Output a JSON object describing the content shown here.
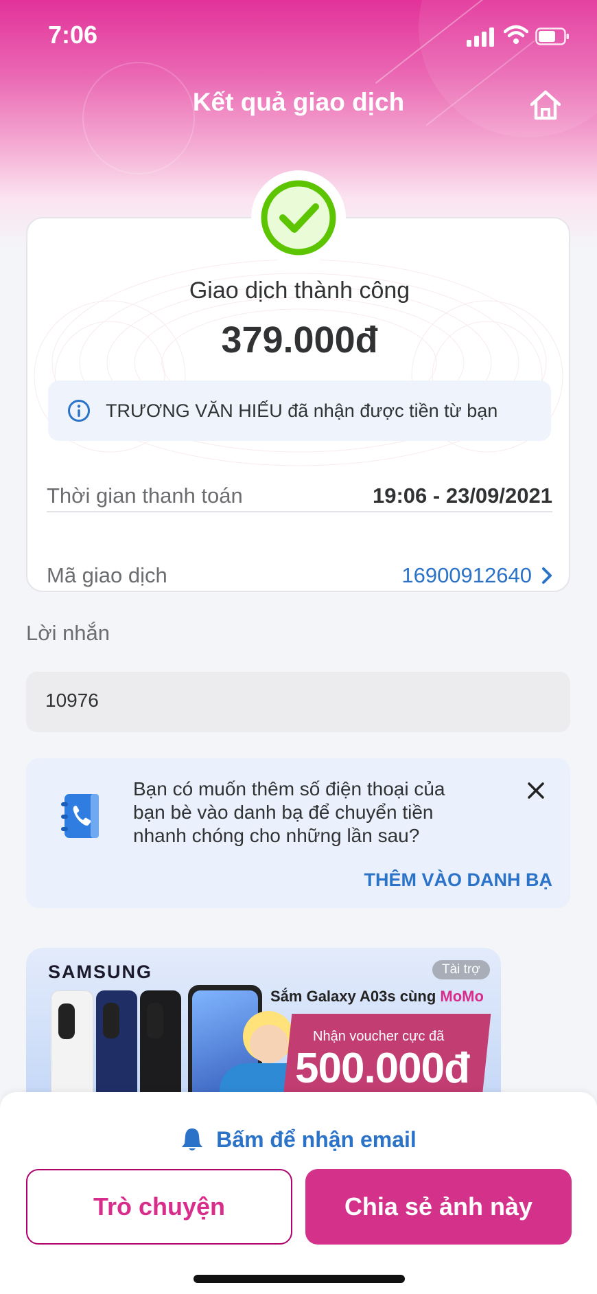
{
  "status_bar": {
    "time": "7:06"
  },
  "header": {
    "title": "Kết quả giao dịch",
    "home_icon": "home-icon"
  },
  "result": {
    "title": "Giao dịch thành công",
    "amount": "379.000đ",
    "info_text": "TRƯƠNG VĂN HIẾU đã nhận được tiền từ bạn",
    "time_label": "Thời gian thanh toán",
    "time_value": "19:06 - 23/09/2021",
    "id_label": "Mã giao dịch",
    "id_value": "16900912640"
  },
  "message": {
    "label": "Lời nhắn",
    "value": "10976"
  },
  "contact_prompt": {
    "text": "Bạn có muốn thêm số điện thoại của bạn bè vào danh bạ để chuyển tiền nhanh chóng cho những lần sau?",
    "action": "THÊM VÀO DANH BẠ"
  },
  "banner": {
    "brand": "SAMSUNG",
    "sponsor": "Tài trợ",
    "promo_title": "Sắm Galaxy A03s cùng ",
    "promo_brand": "MoMo",
    "promo_sub": "Nhận voucher cực đã",
    "promo_amount": "500.000đ"
  },
  "bottom": {
    "email_link": "Bấm để nhận email",
    "chat_button": "Trò chuyện",
    "share_button": "Chia sẻ ảnh này"
  },
  "colors": {
    "brand_pink": "#d4318a",
    "link_blue": "#2b73c8",
    "success_green": "#5cc400"
  }
}
